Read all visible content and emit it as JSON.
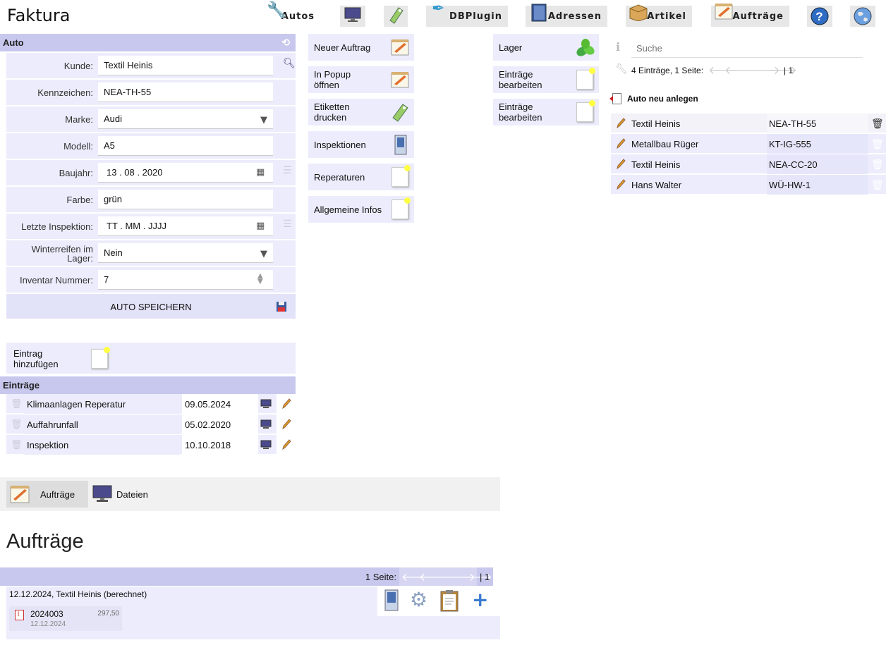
{
  "app": {
    "title": "Faktura"
  },
  "nav": [
    {
      "label": "Autos",
      "icon": "tools-icon"
    },
    {
      "label": "",
      "icon": "monitor-icon"
    },
    {
      "label": "",
      "icon": "tag-icon"
    },
    {
      "label": "DBPlugin",
      "icon": "feather-icon"
    },
    {
      "label": "Adressen",
      "icon": "addressbook-icon"
    },
    {
      "label": "Artikel",
      "icon": "box-icon"
    },
    {
      "label": "Aufträge",
      "icon": "notepad-icon"
    },
    {
      "label": "",
      "icon": "help-icon"
    },
    {
      "label": "",
      "icon": "globe-icon"
    }
  ],
  "auto": {
    "title": "Auto",
    "fields": [
      {
        "label": "Kunde:",
        "value": "Textil Heinis"
      },
      {
        "label": "Kennzeichen:",
        "value": "NEA-TH-55"
      },
      {
        "label": "Marke:",
        "value": "Audi"
      },
      {
        "label": "Modell:",
        "value": "A5"
      },
      {
        "label": "Baujahr:",
        "value": "13 . 08 . 2020"
      },
      {
        "label": "Farbe:",
        "value": "grün"
      },
      {
        "label": "Letzte Inspektion:",
        "value": "TT . MM . JJJJ"
      },
      {
        "label": "Winterreifen im Lager:",
        "value": "Nein"
      },
      {
        "label": "Inventar Nummer:",
        "value": "7"
      }
    ],
    "save_label": "AUTO SPEICHERN"
  },
  "add_entry": "Eintrag hinzufügen",
  "entries": {
    "title": "Einträge",
    "rows": [
      {
        "name": "Klimaanlagen Reperatur",
        "date": "09.05.2024"
      },
      {
        "name": "Auffahrunfall",
        "date": "05.02.2020"
      },
      {
        "name": "Inspektion",
        "date": "10.10.2018"
      }
    ]
  },
  "actions_mid": [
    "Neuer Auftrag",
    "In Popup öffnen",
    "Etiketten drucken",
    "Inspektionen",
    "Reperaturen",
    "Allgemeine Infos"
  ],
  "actions_right": [
    "Lager",
    "Einträge bearbeiten",
    "Einträge bearbeiten"
  ],
  "list": {
    "search_placeholder": "Suche",
    "info": "4 Einträge, 1 Seite:",
    "pages": "| 1",
    "new_label": "Auto neu anlegen",
    "rows": [
      {
        "name": "Textil Heinis",
        "plate": "NEA-TH-55"
      },
      {
        "name": "Metallbau Rüger",
        "plate": "KT-IG-555"
      },
      {
        "name": "Textil Heinis",
        "plate": "NEA-CC-20"
      },
      {
        "name": "Hans Walter",
        "plate": "WÜ-HW-1"
      }
    ]
  },
  "tabs": [
    {
      "label": "Aufträge"
    },
    {
      "label": "Dateien"
    }
  ],
  "orders": {
    "heading": "Aufträge",
    "pager_label": "1 Seite:",
    "pages": "| 1",
    "row_title": "12.12.2024, Textil Heinis (berechnet)",
    "doc_number": "2024003",
    "doc_amount": "297,50",
    "doc_date": "12.12.2024"
  }
}
